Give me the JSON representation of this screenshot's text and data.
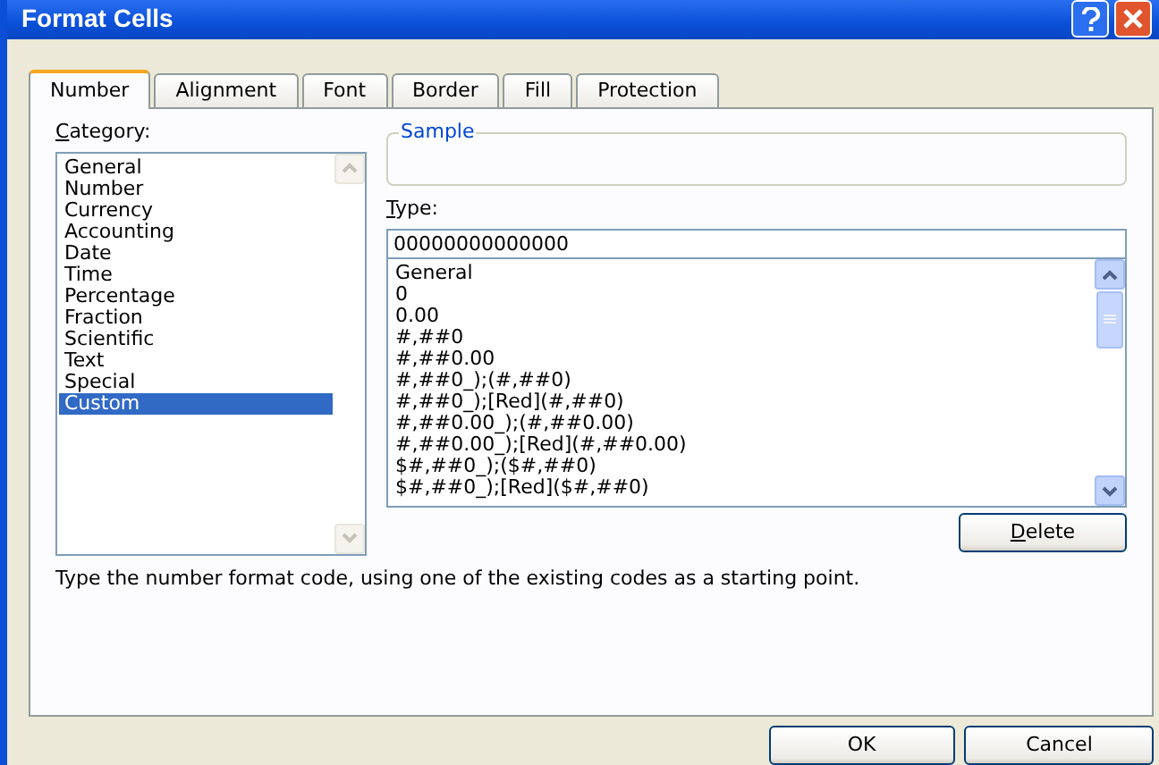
{
  "window": {
    "title": "Format Cells"
  },
  "tabs": [
    {
      "label": "Number",
      "selected": true
    },
    {
      "label": "Alignment",
      "selected": false
    },
    {
      "label": "Font",
      "selected": false
    },
    {
      "label": "Border",
      "selected": false
    },
    {
      "label": "Fill",
      "selected": false
    },
    {
      "label": "Protection",
      "selected": false
    }
  ],
  "category": {
    "label": {
      "accel": "C",
      "rest": "ategory:"
    },
    "items": [
      {
        "label": "General",
        "selected": false
      },
      {
        "label": "Number",
        "selected": false
      },
      {
        "label": "Currency",
        "selected": false
      },
      {
        "label": "Accounting",
        "selected": false
      },
      {
        "label": "Date",
        "selected": false
      },
      {
        "label": "Time",
        "selected": false
      },
      {
        "label": "Percentage",
        "selected": false
      },
      {
        "label": "Fraction",
        "selected": false
      },
      {
        "label": "Scientific",
        "selected": false
      },
      {
        "label": "Text",
        "selected": false
      },
      {
        "label": "Special",
        "selected": false
      },
      {
        "label": "Custom",
        "selected": true
      }
    ]
  },
  "sample": {
    "label": "Sample"
  },
  "type": {
    "label": {
      "accel": "T",
      "rest": "ype:"
    },
    "value": "00000000000000",
    "formats": [
      "General",
      "0",
      "0.00",
      "#,##0",
      "#,##0.00",
      "#,##0_);(#,##0)",
      "#,##0_);[Red](#,##0)",
      "#,##0.00_);(#,##0.00)",
      "#,##0.00_);[Red](#,##0.00)",
      "$#,##0_);($#,##0)",
      "$#,##0_);[Red]($#,##0)"
    ]
  },
  "delete_button": {
    "accel": "D",
    "rest": "elete"
  },
  "description": "Type the number format code, using one of the existing codes as a starting point.",
  "buttons": [
    "OK",
    "Cancel"
  ]
}
